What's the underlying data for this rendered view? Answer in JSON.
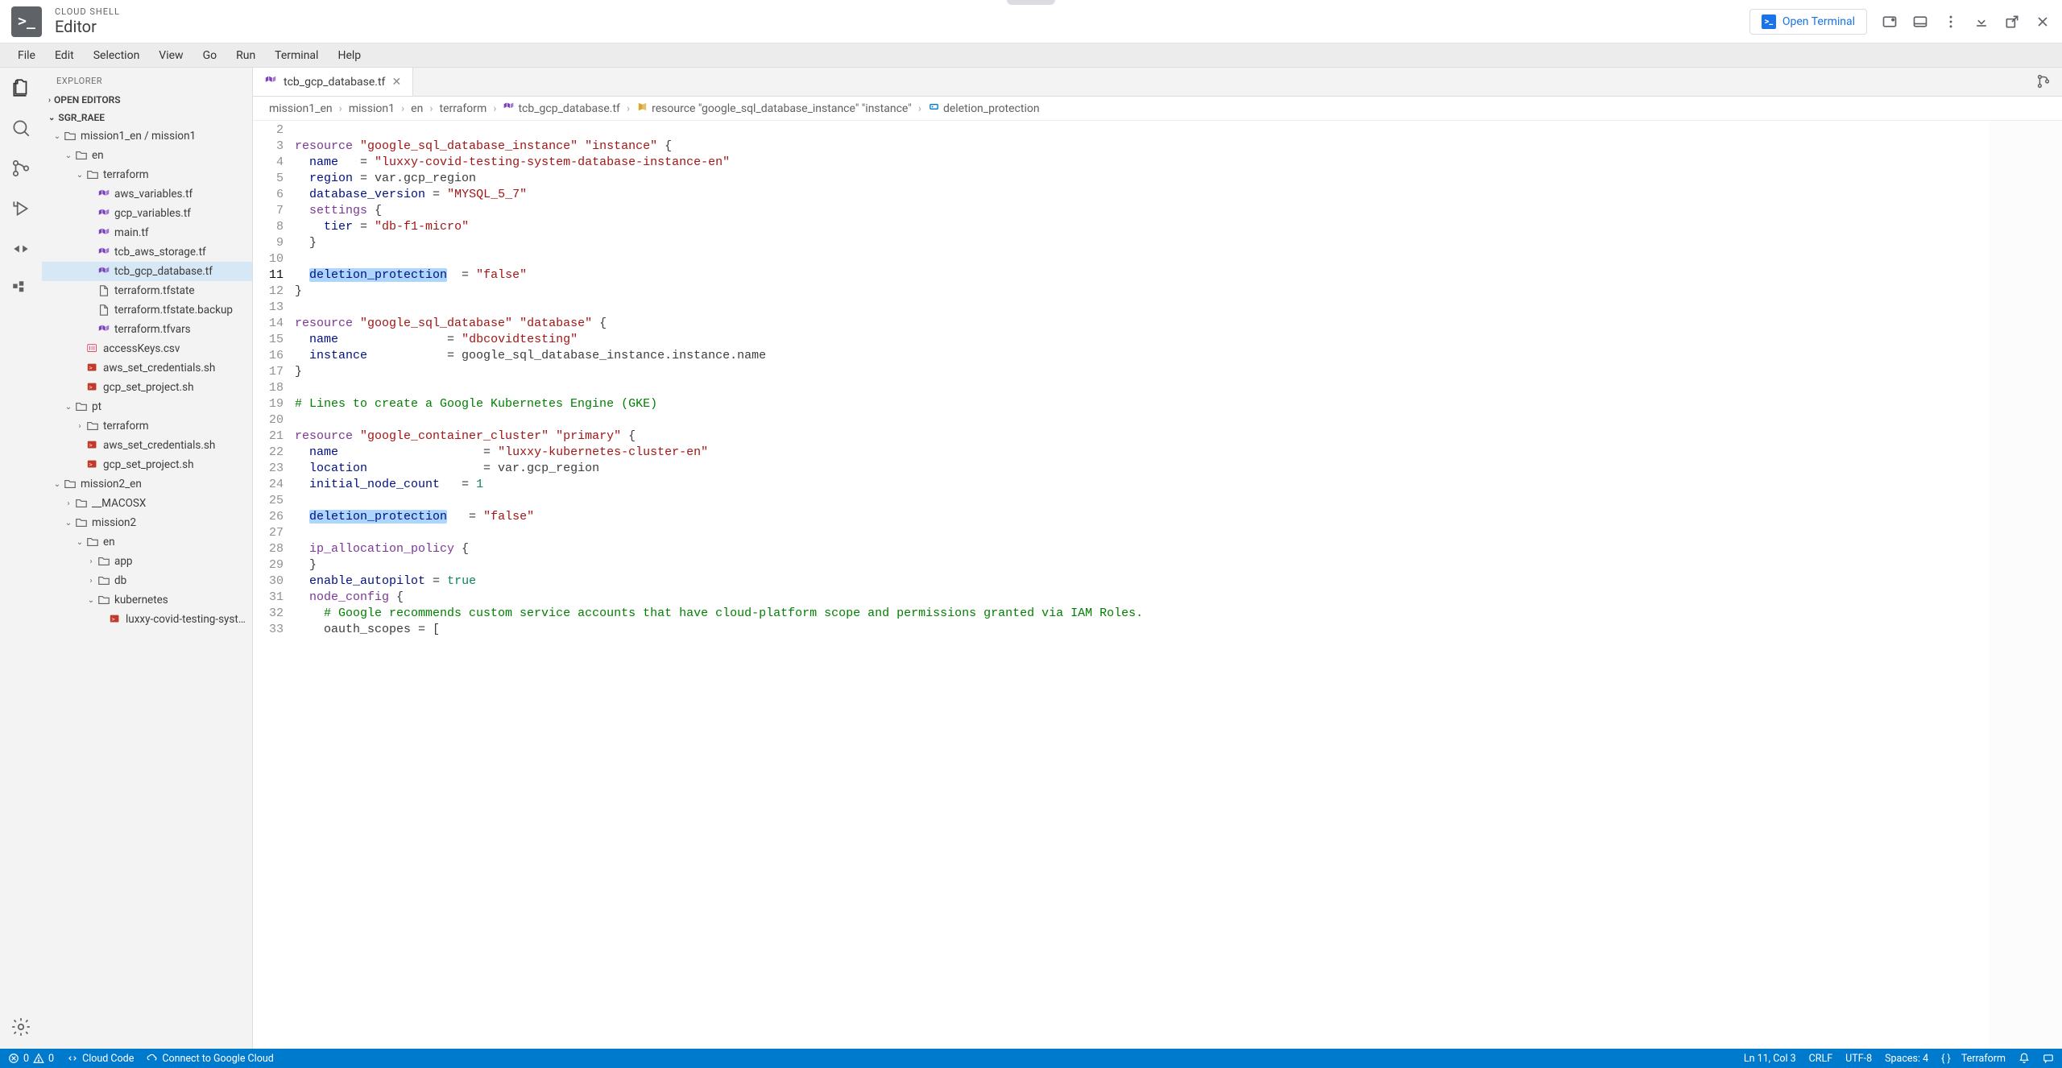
{
  "titlebar": {
    "kicker": "CLOUD SHELL",
    "title": "Editor",
    "open_terminal": "Open Terminal"
  },
  "menu": [
    "File",
    "Edit",
    "Selection",
    "View",
    "Go",
    "Run",
    "Terminal",
    "Help"
  ],
  "explorer": {
    "panel": "EXPLORER",
    "open_editors": "OPEN EDITORS",
    "workspace": "SGR_RAEE",
    "root_folder": "mission1_en / mission1",
    "tree": [
      {
        "depth": 1,
        "type": "folder",
        "open": true,
        "label": "mission1_en / mission1"
      },
      {
        "depth": 2,
        "type": "folder",
        "open": true,
        "label": "en"
      },
      {
        "depth": 3,
        "type": "folder",
        "open": true,
        "label": "terraform"
      },
      {
        "depth": 4,
        "type": "tf",
        "label": "aws_variables.tf"
      },
      {
        "depth": 4,
        "type": "tf",
        "label": "gcp_variables.tf"
      },
      {
        "depth": 4,
        "type": "tf",
        "label": "main.tf"
      },
      {
        "depth": 4,
        "type": "tf",
        "label": "tcb_aws_storage.tf"
      },
      {
        "depth": 4,
        "type": "tf",
        "label": "tcb_gcp_database.tf",
        "selected": true
      },
      {
        "depth": 4,
        "type": "file",
        "label": "terraform.tfstate"
      },
      {
        "depth": 4,
        "type": "file",
        "label": "terraform.tfstate.backup"
      },
      {
        "depth": 4,
        "type": "tf",
        "label": "terraform.tfvars"
      },
      {
        "depth": 3,
        "type": "csv",
        "label": "accessKeys.csv"
      },
      {
        "depth": 3,
        "type": "sh",
        "label": "aws_set_credentials.sh"
      },
      {
        "depth": 3,
        "type": "sh",
        "label": "gcp_set_project.sh"
      },
      {
        "depth": 2,
        "type": "folder",
        "open": true,
        "label": "pt"
      },
      {
        "depth": 3,
        "type": "folder",
        "open": false,
        "label": "terraform"
      },
      {
        "depth": 3,
        "type": "sh",
        "label": "aws_set_credentials.sh"
      },
      {
        "depth": 3,
        "type": "sh",
        "label": "gcp_set_project.sh"
      },
      {
        "depth": 1,
        "type": "folder",
        "open": true,
        "label": "mission2_en"
      },
      {
        "depth": 2,
        "type": "folder",
        "open": false,
        "label": "__MACOSX"
      },
      {
        "depth": 2,
        "type": "folder",
        "open": true,
        "label": "mission2"
      },
      {
        "depth": 3,
        "type": "folder",
        "open": true,
        "label": "en"
      },
      {
        "depth": 4,
        "type": "folder",
        "open": false,
        "label": "app"
      },
      {
        "depth": 4,
        "type": "folder",
        "open": false,
        "label": "db"
      },
      {
        "depth": 4,
        "type": "folder",
        "open": true,
        "label": "kubernetes"
      },
      {
        "depth": 5,
        "type": "sh",
        "label": "luxxy-covid-testing-syst…"
      }
    ]
  },
  "tabs": [
    {
      "label": "tcb_gcp_database.tf",
      "icon": "tf"
    }
  ],
  "breadcrumbs": [
    {
      "label": "mission1_en"
    },
    {
      "label": "mission1"
    },
    {
      "label": "en"
    },
    {
      "label": "terraform"
    },
    {
      "label": "tcb_gcp_database.tf",
      "icon": "tf"
    },
    {
      "label": "resource \"google_sql_database_instance\" \"instance\"",
      "icon": "symbol"
    },
    {
      "label": "deletion_protection",
      "icon": "field"
    }
  ],
  "editor": {
    "first_line": 2,
    "cursor_line": 11,
    "lines": [
      {
        "n": 2,
        "html": ""
      },
      {
        "n": 3,
        "html": "<span class='kw'>resource</span> <span class='str'>\"google_sql_database_instance\"</span> <span class='str'>\"instance\"</span> {"
      },
      {
        "n": 4,
        "html": "  <span class='ident'>name</span>   = <span class='str'>\"luxxy-covid-testing-system-database-instance-en\"</span>"
      },
      {
        "n": 5,
        "html": "  <span class='ident'>region</span> = var.gcp_region"
      },
      {
        "n": 6,
        "html": "  <span class='ident'>database_version</span> = <span class='str'>\"MYSQL_5_7\"</span>"
      },
      {
        "n": 7,
        "html": "  <span class='kw'>settings</span> {"
      },
      {
        "n": 8,
        "html": "    <span class='ident'>tier</span> = <span class='str'>\"db-f1-micro\"</span>"
      },
      {
        "n": 9,
        "html": "  }"
      },
      {
        "n": 10,
        "html": ""
      },
      {
        "n": 11,
        "html": "  <span class='hl'><span class='ident'>deletion_protection</span></span>  = <span class='str'>\"false\"</span>"
      },
      {
        "n": 12,
        "html": "}"
      },
      {
        "n": 13,
        "html": ""
      },
      {
        "n": 14,
        "html": "<span class='kw'>resource</span> <span class='str'>\"google_sql_database\"</span> <span class='str'>\"database\"</span> {"
      },
      {
        "n": 15,
        "html": "  <span class='ident'>name</span>               = <span class='str'>\"dbcovidtesting\"</span>"
      },
      {
        "n": 16,
        "html": "  <span class='ident'>instance</span>           = google_sql_database_instance.instance.name"
      },
      {
        "n": 17,
        "html": "}"
      },
      {
        "n": 18,
        "html": ""
      },
      {
        "n": 19,
        "html": "<span class='cmt'># Lines to create a Google Kubernetes Engine (GKE)</span>"
      },
      {
        "n": 20,
        "html": ""
      },
      {
        "n": 21,
        "html": "<span class='kw'>resource</span> <span class='str'>\"google_container_cluster\"</span> <span class='str'>\"primary\"</span> {"
      },
      {
        "n": 22,
        "html": "  <span class='ident'>name</span>                    = <span class='str'>\"luxxy-kubernetes-cluster-en\"</span>"
      },
      {
        "n": 23,
        "html": "  <span class='ident'>location</span>                = var.gcp_region"
      },
      {
        "n": 24,
        "html": "  <span class='ident'>initial_node_count</span>   = <span class='num'>1</span>"
      },
      {
        "n": 25,
        "html": ""
      },
      {
        "n": 26,
        "html": "  <span class='hl'><span class='ident'>deletion_protection</span></span>   = <span class='str'>\"false\"</span>"
      },
      {
        "n": 27,
        "html": ""
      },
      {
        "n": 28,
        "html": "  <span class='kw'>ip_allocation_policy</span> {"
      },
      {
        "n": 29,
        "html": "  }"
      },
      {
        "n": 30,
        "html": "  <span class='ident'>enable_autopilot</span> = <span class='num'>true</span>"
      },
      {
        "n": 31,
        "html": "  <span class='kw'>node_config</span> {"
      },
      {
        "n": 32,
        "html": "    <span class='cmt'># Google recommends custom service accounts that have cloud-platform scope and permissions granted via IAM Roles.</span>"
      },
      {
        "n": 33,
        "html": "    oauth_scopes = ["
      }
    ]
  },
  "status": {
    "errors": "0",
    "warnings": "0",
    "cloud_code": "Cloud Code",
    "connect_gcloud": "Connect to Google Cloud",
    "cursor": "Ln 11, Col 3",
    "eol": "CRLF",
    "encoding": "UTF-8",
    "indent": "Spaces: 4",
    "lang": "Terraform"
  }
}
